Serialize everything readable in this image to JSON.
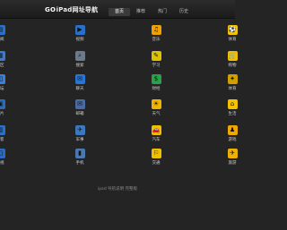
{
  "header": {
    "logo_mark": "GO",
    "logo_text": "iPad网址导航",
    "nav": [
      "首页",
      "推荐",
      "热门",
      "历史"
    ]
  },
  "grid": [
    [
      {
        "label": "视频",
        "icon": "video-icon",
        "glyph": "▶",
        "color": "#2a70c8"
      },
      {
        "label": "音乐",
        "icon": "music-icon",
        "glyph": "♫",
        "color": "#f0a000"
      },
      {
        "label": "体育",
        "icon": "sports-icon",
        "glyph": "⚽",
        "color": "#f5c300"
      }
    ],
    [
      {
        "label": "搜索",
        "icon": "search-icon",
        "glyph": "⌕",
        "color": "#6c7a8a"
      },
      {
        "label": "学习",
        "icon": "study-icon",
        "glyph": "✎",
        "color": "#e0c100"
      },
      {
        "label": "购物",
        "icon": "shopping-icon",
        "glyph": "🛒",
        "color": "#f0c000"
      }
    ],
    [
      {
        "label": "聊天",
        "icon": "chat-icon",
        "glyph": "✉",
        "color": "#2a75d0"
      },
      {
        "label": "财经",
        "icon": "finance-icon",
        "glyph": "$",
        "color": "#2aa04a"
      },
      {
        "label": "体育",
        "icon": "lottery-icon",
        "glyph": "✦",
        "color": "#d0a000"
      }
    ],
    [
      {
        "label": "邮箱",
        "icon": "mail-icon",
        "glyph": "✉",
        "color": "#4a6aa0"
      },
      {
        "label": "天气",
        "icon": "weather-icon",
        "glyph": "☀",
        "color": "#f0b400"
      },
      {
        "label": "生活",
        "icon": "life-icon",
        "glyph": "⌂",
        "color": "#f5c200"
      }
    ],
    [
      {
        "label": "军事",
        "icon": "military-icon",
        "glyph": "✈",
        "color": "#3a78c0"
      },
      {
        "label": "汽车",
        "icon": "car-icon",
        "glyph": "🚗",
        "color": "#f0c000"
      },
      {
        "label": "游戏",
        "icon": "game-icon",
        "glyph": "♟",
        "color": "#f0a800"
      }
    ],
    [
      {
        "label": "手机",
        "icon": "mobile-icon",
        "glyph": "▮",
        "color": "#4a78b0"
      },
      {
        "label": "交通",
        "icon": "transport-icon",
        "glyph": "⚐",
        "color": "#f0c000"
      },
      {
        "label": "旅游",
        "icon": "travel-icon",
        "glyph": "✈",
        "color": "#f0b000"
      }
    ]
  ],
  "left_col": [
    {
      "label": "新闻",
      "icon": "news-icon",
      "glyph": "▤",
      "color": "#2a70c8"
    },
    {
      "label": "社区",
      "icon": "community-icon",
      "glyph": "▦",
      "color": "#3a7ad0"
    },
    {
      "label": "论坛",
      "icon": "forum-icon",
      "glyph": "◫",
      "color": "#3a80d8"
    },
    {
      "label": "图片",
      "icon": "photo-icon",
      "glyph": "▣",
      "color": "#2a6cb8"
    },
    {
      "label": "博客",
      "icon": "blog-icon",
      "glyph": "▥",
      "color": "#2a70c8"
    },
    {
      "label": "电视",
      "icon": "tv-icon",
      "glyph": "▢",
      "color": "#2a6ac0"
    }
  ],
  "footer": {
    "text": "ipad 导航说明  完整版"
  }
}
